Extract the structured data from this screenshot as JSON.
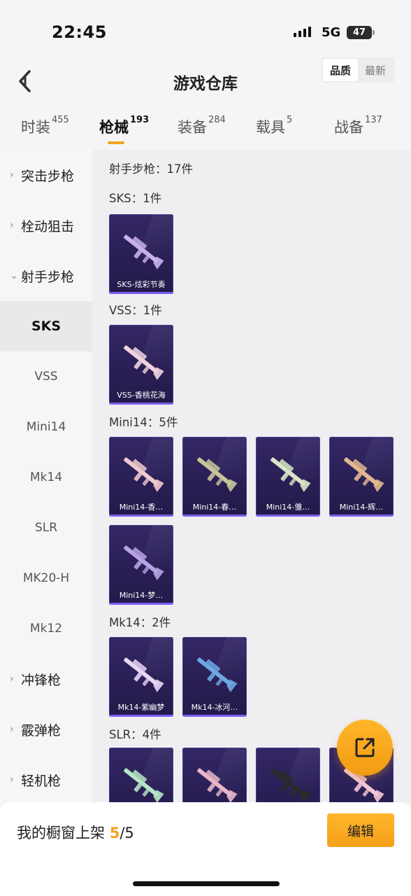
{
  "status_bar": {
    "time": "22:45",
    "network": "5G",
    "battery": "47"
  },
  "header": {
    "title": "游戏仓库",
    "sort_options": [
      "品质",
      "最新"
    ],
    "sort_active": "品质"
  },
  "tabs": [
    {
      "label": "时装",
      "count": "455"
    },
    {
      "label": "枪械",
      "count": "193"
    },
    {
      "label": "装备",
      "count": "284"
    },
    {
      "label": "载具",
      "count": "5"
    },
    {
      "label": "战备",
      "count": "137"
    }
  ],
  "sidebar": {
    "groups": [
      {
        "label": "突击步枪",
        "expanded": false
      },
      {
        "label": "栓动狙击",
        "expanded": false
      },
      {
        "label": "射手步枪",
        "expanded": true
      }
    ],
    "sub_items": [
      "SKS",
      "VSS",
      "Mini14",
      "Mk14",
      "SLR",
      "MK20-H",
      "Mk12"
    ],
    "active_sub": "SKS",
    "more_groups": [
      "冲锋枪",
      "霰弹枪",
      "轻机枪"
    ]
  },
  "content": {
    "summary": "射手步枪：17件",
    "sections": [
      {
        "label": "SKS：1件",
        "items": [
          "SKS-炫彩节奏"
        ]
      },
      {
        "label": "VSS：1件",
        "items": [
          "VSS-香桃花海"
        ]
      },
      {
        "label": "Mini14：5件",
        "items": [
          "Mini14-香…",
          "Mini14-春…",
          "Mini14-雏…",
          "Mini14-辉…",
          "Mini14-梦…"
        ]
      },
      {
        "label": "Mk14：2件",
        "items": [
          "Mk14-紫幽梦",
          "Mk14-冰河…"
        ]
      },
      {
        "label": "SLR：4件",
        "items": [
          "",
          "",
          "",
          ""
        ]
      }
    ]
  },
  "gun_colors": {
    "sks": "#c9b2e8",
    "vss": "#f1d4df",
    "mini1": "#f0c9cf",
    "mini2": "#c9c59a",
    "mini3": "#d8e6c6",
    "mini4": "#e2b88f",
    "mini5": "#b7a3e6",
    "mk1": "#e7d6f6",
    "mk2": "#6fa9e6",
    "slr1": "#b6e6c6",
    "slr2": "#e9b6c9",
    "slr3": "#2a2a2a",
    "slr4": "#f3c8d5"
  },
  "bottom_bar": {
    "label": "我的橱窗上架",
    "count": "5",
    "total": "/5",
    "edit_label": "编辑"
  }
}
